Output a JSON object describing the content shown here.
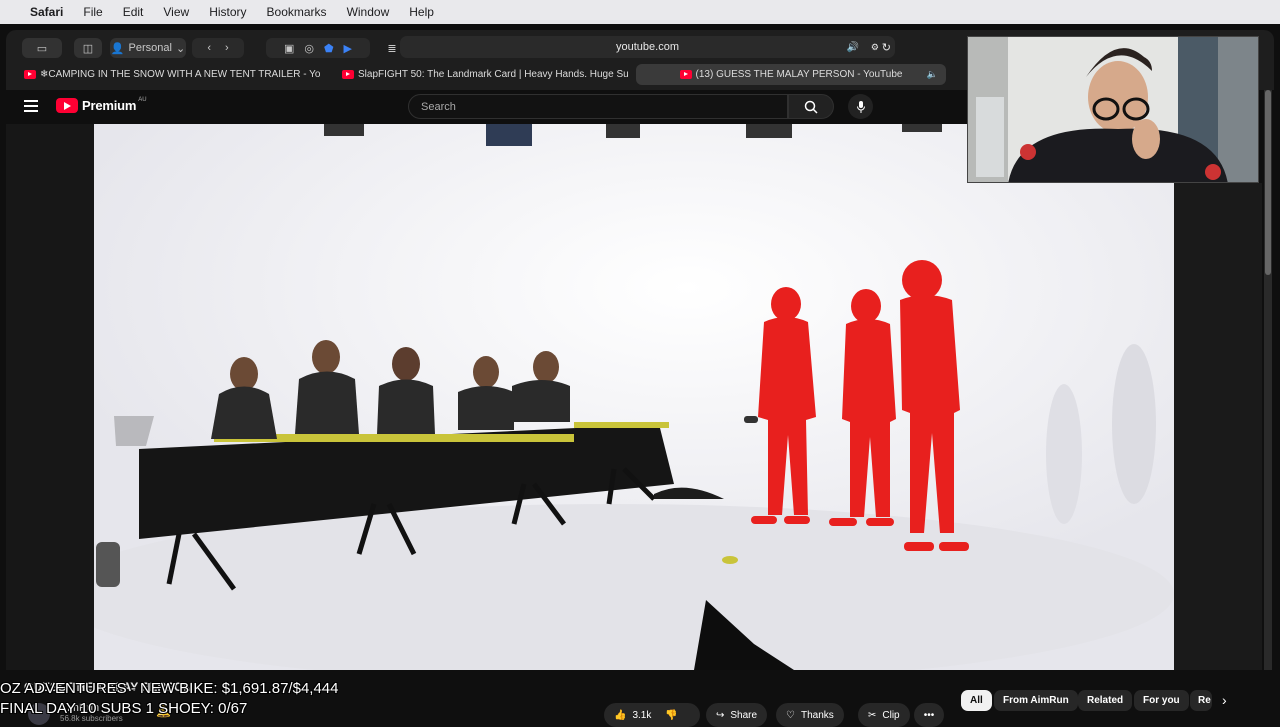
{
  "menubar": {
    "app": "Safari",
    "items": [
      "File",
      "Edit",
      "View",
      "History",
      "Bookmarks",
      "Window",
      "Help"
    ]
  },
  "toolbar": {
    "profile": "Personal",
    "address": "youtube.com"
  },
  "tabs": [
    {
      "label": "❄CAMPING IN THE SNOW WITH A NEW TENT TRAILER - YouT..."
    },
    {
      "label": "SlapFIGHT 50: The Landmark Card | Heavy Hands. Huge Surp..."
    },
    {
      "label": "(13) GUESS THE MALAY PERSON - YouTube"
    }
  ],
  "youtube": {
    "logo_text": "Premium",
    "region": "AU",
    "search_placeholder": "Search"
  },
  "overlay": {
    "line1": "OZ ADVENTURES - NEW BIKE: $1,691.87/$4,444",
    "line2": "FINAL DAY 10 SUBS 1 SHOEY: 0/67"
  },
  "video_info": {
    "title": "GUESS THE MALAY PERSON",
    "channel": "AimRun",
    "subscribers": "56.8k subscribers"
  },
  "actions": {
    "likes": "3.1k",
    "share": "Share",
    "thanks": "Thanks",
    "clip": "Clip"
  },
  "chips": [
    "All",
    "From AimRun",
    "Related",
    "For you",
    "Re"
  ],
  "colors": {
    "accent": "#ff0033",
    "suits": "#e8201e",
    "background": "#0f0f0f"
  }
}
